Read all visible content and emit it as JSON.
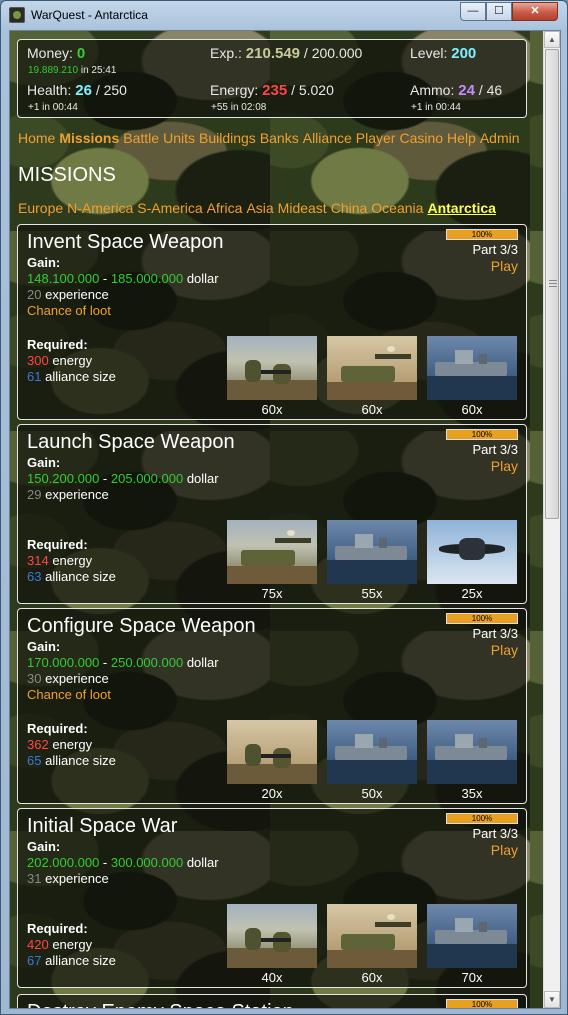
{
  "window": {
    "title": "WarQuest - Antarctica",
    "minimize": "—",
    "maximize": "☐",
    "close": "✕"
  },
  "stats": {
    "money_label": "Money:",
    "money": "0",
    "money_sub_value": "19.889.210",
    "money_sub_text": "in 25:41",
    "exp_label": "Exp.:",
    "exp": "210.549",
    "exp_max": "/ 200.000",
    "level_label": "Level:",
    "level": "200",
    "health_label": "Health:",
    "health": "26",
    "health_max": "/ 250",
    "health_sub": "+1 in 00:44",
    "energy_label": "Energy:",
    "energy": "235",
    "energy_max": "/ 5.020",
    "energy_sub": "+55 in 02:08",
    "ammo_label": "Ammo:",
    "ammo": "24",
    "ammo_max": "/ 46",
    "ammo_sub": "+1 in 00:44"
  },
  "nav": [
    {
      "label": "Home",
      "active": false
    },
    {
      "label": "Missions",
      "active": true
    },
    {
      "label": "Battle",
      "active": false
    },
    {
      "label": "Units",
      "active": false
    },
    {
      "label": "Buildings",
      "active": false
    },
    {
      "label": "Banks",
      "active": false
    },
    {
      "label": "Alliance",
      "active": false
    },
    {
      "label": "Player",
      "active": false
    },
    {
      "label": "Casino",
      "active": false
    },
    {
      "label": "Help",
      "active": false
    },
    {
      "label": "Admin",
      "active": false
    }
  ],
  "heading": "MISSIONS",
  "regions": [
    {
      "label": "Europe",
      "current": false
    },
    {
      "label": "N-America",
      "current": false
    },
    {
      "label": "S-America",
      "current": false
    },
    {
      "label": "Africa",
      "current": false
    },
    {
      "label": "Asia",
      "current": false
    },
    {
      "label": "Mideast",
      "current": false
    },
    {
      "label": "China",
      "current": false
    },
    {
      "label": "Oceania",
      "current": false
    },
    {
      "label": "Antarctica",
      "current": true
    }
  ],
  "labels": {
    "gain": "Gain:",
    "required": "Required:",
    "dash": "-",
    "dollar": "dollar",
    "experience": "experience",
    "energy": "energy",
    "alliance": "alliance size",
    "loot": "Chance of loot",
    "play": "Play"
  },
  "missions": [
    {
      "title": "Invent Space Weapon",
      "progress": "100%",
      "part": "Part 3/3",
      "gain_min": "148.100.000",
      "gain_max": "185.000.000",
      "xp": "20",
      "loot": true,
      "energy": "300",
      "alliance": "61",
      "units": [
        {
          "img": "soldier",
          "count": "60x"
        },
        {
          "img": "artillery",
          "count": "60x"
        },
        {
          "img": "carrier",
          "count": "60x"
        }
      ]
    },
    {
      "title": "Launch Space Weapon",
      "progress": "100%",
      "part": "Part 3/3",
      "gain_min": "150.200.000",
      "gain_max": "205.000.000",
      "xp": "29",
      "loot": false,
      "energy": "314",
      "alliance": "63",
      "units": [
        {
          "img": "howitzer",
          "count": "75x"
        },
        {
          "img": "carrier",
          "count": "55x"
        },
        {
          "img": "stealth",
          "count": "25x"
        }
      ]
    },
    {
      "title": "Configure Space Weapon",
      "progress": "100%",
      "part": "Part 3/3",
      "gain_min": "170.000.000",
      "gain_max": "250.000.000",
      "xp": "30",
      "loot": true,
      "energy": "362",
      "alliance": "65",
      "units": [
        {
          "img": "infantry",
          "count": "20x"
        },
        {
          "img": "patrolboat",
          "count": "50x"
        },
        {
          "img": "carrier",
          "count": "35x"
        }
      ]
    },
    {
      "title": "Initial Space War",
      "progress": "100%",
      "part": "Part 3/3",
      "gain_min": "202.000.000",
      "gain_max": "300.000.000",
      "xp": "31",
      "loot": false,
      "energy": "420",
      "alliance": "67",
      "units": [
        {
          "img": "mortar",
          "count": "40x"
        },
        {
          "img": "rocket",
          "count": "60x"
        },
        {
          "img": "destroyer",
          "count": "70x"
        }
      ]
    },
    {
      "title": "Destroy Enemy Space Station",
      "progress": "100%"
    }
  ],
  "colors": {
    "gain": "#33cc33",
    "link": "#f0a030",
    "energy": "#ff4646",
    "alliance": "#3a7ad6"
  }
}
